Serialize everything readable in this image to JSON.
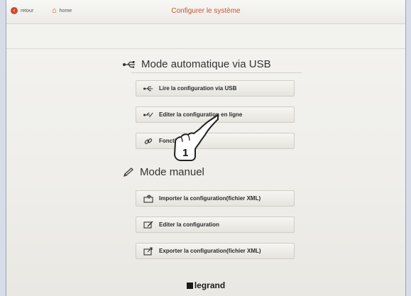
{
  "header": {
    "back_label": "retour",
    "home_label": "home",
    "title": "Configurer le système"
  },
  "usb_section": {
    "title": "Mode automatique via USB",
    "icon": "usb-icon",
    "buttons": [
      {
        "label": "Lire la configuration via USB",
        "icon": "usb-icon"
      },
      {
        "label": "Editer la configuration en ligne",
        "icon": "usb-edit-icon"
      },
      {
        "label": "Fonctionnalier",
        "icon": "link-icon"
      }
    ]
  },
  "manual_section": {
    "title": "Mode manuel",
    "icon": "pencil-icon",
    "buttons": [
      {
        "label": "Importer la configuration(fichier XML)",
        "icon": "import-icon"
      },
      {
        "label": "Editer la configuration",
        "icon": "edit-icon"
      },
      {
        "label": "Exporter la configuration(fichier XML)",
        "icon": "export-icon"
      }
    ]
  },
  "callout": {
    "number": "1"
  },
  "footer": {
    "logo": "legrand"
  },
  "colors": {
    "accent": "#c9532a",
    "background": "#efeeea"
  }
}
